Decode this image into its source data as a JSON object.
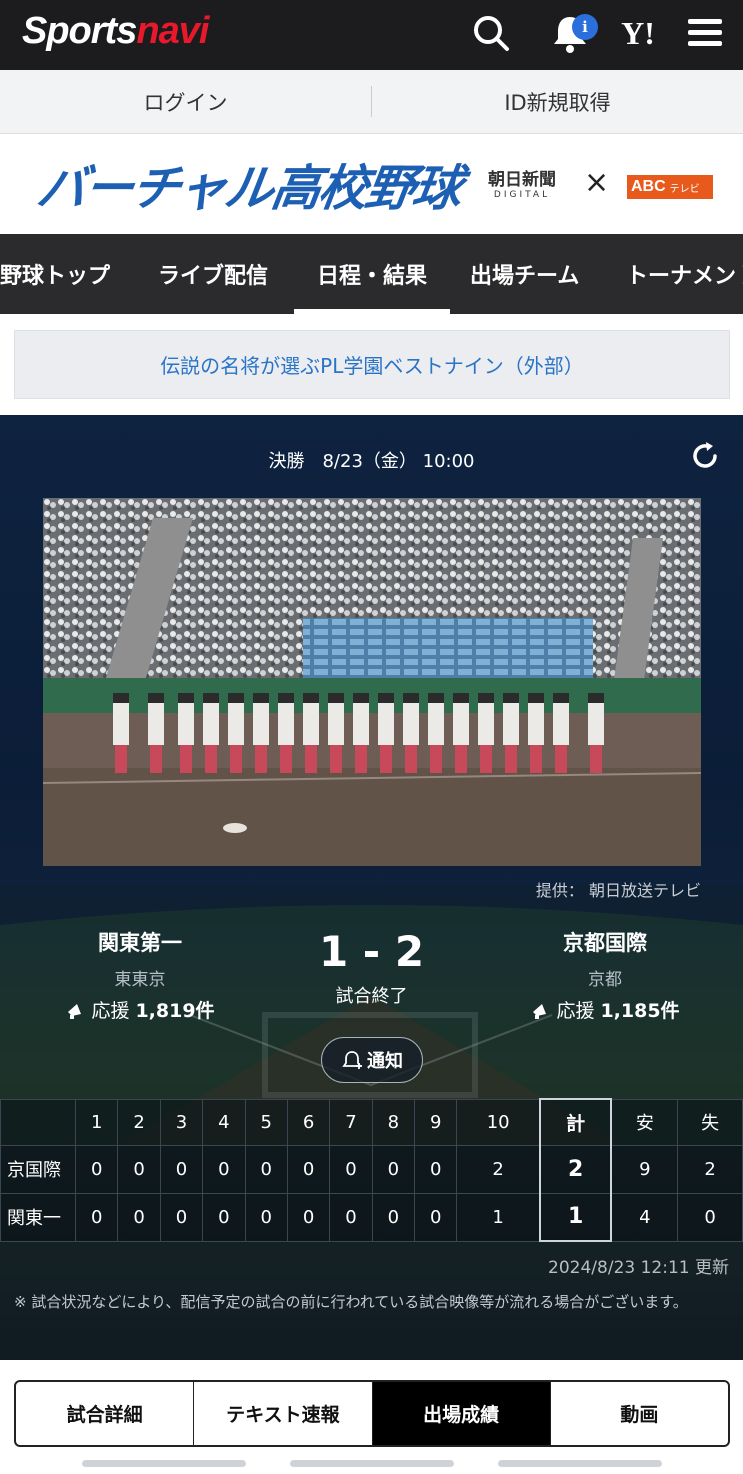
{
  "header": {
    "logo_part1": "Sports",
    "logo_part2": "navi",
    "notification_badge": "i",
    "yahoo_label": "Y!"
  },
  "auth": {
    "login": "ログイン",
    "signup": "ID新規取得"
  },
  "banner": {
    "title": "バーチャル高校野球",
    "partner1_line1": "朝日新聞",
    "partner1_line2": "DIGITAL",
    "times": "×",
    "partner2": "ABC",
    "partner2_sub": "テレビ"
  },
  "nav": {
    "tabs": [
      "野球トップ",
      "ライブ配信",
      "日程・結果",
      "出場チーム",
      "トーナメント"
    ],
    "active_index": 2
  },
  "promo": {
    "text": "伝説の名将が選ぶPL学園ベストナイン（外部）"
  },
  "game": {
    "round_info": "決勝　8/23（金） 10:00",
    "provider": "提供： 朝日放送テレビ",
    "home": {
      "name": "関東第一",
      "pref": "東東京",
      "cheer_label": "応援",
      "cheer_count": "1,819件"
    },
    "away": {
      "name": "京都国際",
      "pref": "京都",
      "cheer_label": "応援",
      "cheer_count": "1,185件"
    },
    "score": "1 - 2",
    "status": "試合終了",
    "notify_label": "通知"
  },
  "scoreboard": {
    "headers": [
      "1",
      "2",
      "3",
      "4",
      "5",
      "6",
      "7",
      "8",
      "9",
      "10",
      "計",
      "安",
      "失"
    ],
    "rows": [
      {
        "team": "京国際",
        "innings": [
          "0",
          "0",
          "0",
          "0",
          "0",
          "0",
          "0",
          "0",
          "0",
          "2"
        ],
        "total": "2",
        "hits": "9",
        "errors": "2"
      },
      {
        "team": "関東一",
        "innings": [
          "0",
          "0",
          "0",
          "0",
          "0",
          "0",
          "0",
          "0",
          "0",
          "1"
        ],
        "total": "1",
        "hits": "4",
        "errors": "0"
      }
    ],
    "updated": "2024/8/23 12:11 更新",
    "note": "※ 試合状況などにより、配信予定の試合の前に行われている試合映像等が流れる場合がございます。"
  },
  "bottom_tabs": {
    "tabs": [
      "試合詳細",
      "テキスト速報",
      "出場成績",
      "動画"
    ],
    "active_index": 2
  }
}
